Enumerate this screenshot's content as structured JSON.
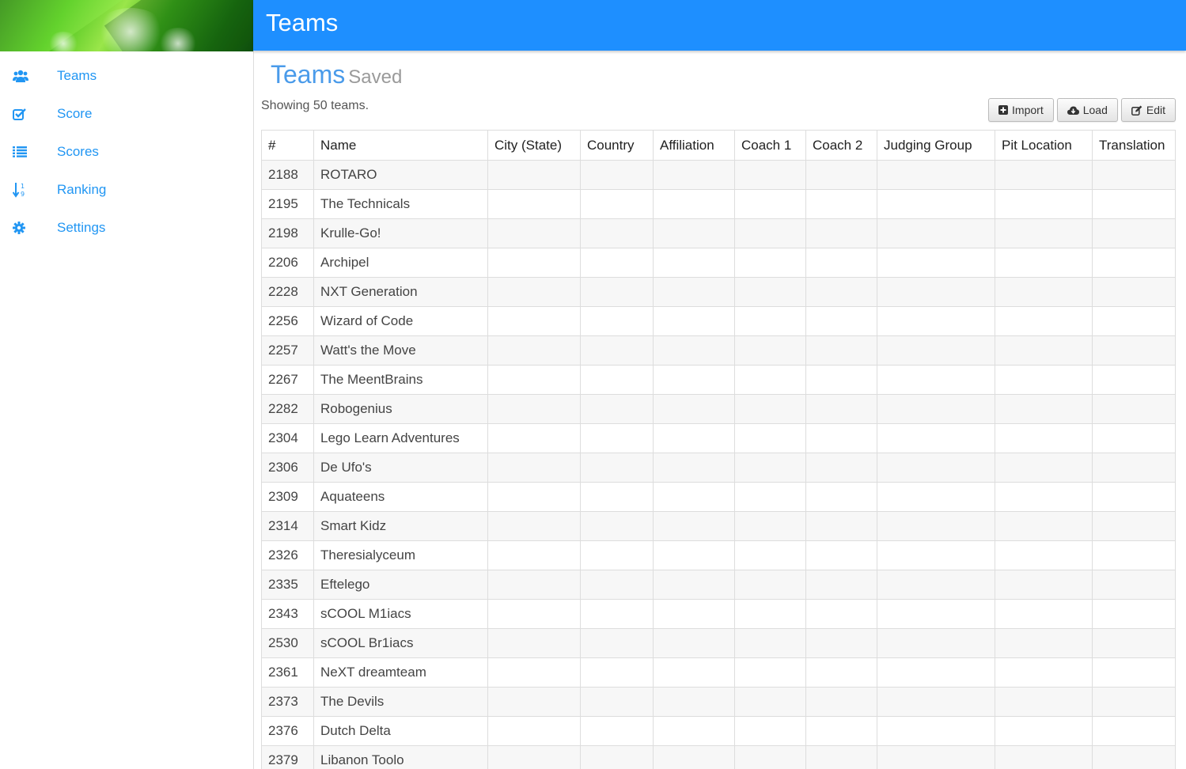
{
  "header": {
    "title": "Teams"
  },
  "sidebar": {
    "items": [
      {
        "icon": "users-icon",
        "label": "Teams"
      },
      {
        "icon": "check-square-icon",
        "label": "Score"
      },
      {
        "icon": "list-icon",
        "label": "Scores"
      },
      {
        "icon": "sort-numeric-icon",
        "label": "Ranking"
      },
      {
        "icon": "gear-icon",
        "label": "Settings"
      }
    ]
  },
  "main": {
    "title": "Teams",
    "subtitle": "Saved",
    "count_text": "Showing 50 teams.",
    "toolbar": {
      "import_label": "Import",
      "load_label": "Load",
      "edit_label": "Edit"
    },
    "table": {
      "columns": [
        "#",
        "Name",
        "City (State)",
        "Country",
        "Affiliation",
        "Coach 1",
        "Coach 2",
        "Judging Group",
        "Pit Location",
        "Translation"
      ],
      "rows": [
        [
          "2188",
          "ROTARO"
        ],
        [
          "2195",
          "The Technicals"
        ],
        [
          "2198",
          "Krulle-Go!"
        ],
        [
          "2206",
          "Archipel"
        ],
        [
          "2228",
          "NXT Generation"
        ],
        [
          "2256",
          "Wizard of Code"
        ],
        [
          "2257",
          "Watt's the Move"
        ],
        [
          "2267",
          "The MeentBrains"
        ],
        [
          "2282",
          "Robogenius"
        ],
        [
          "2304",
          "Lego Learn Adventures"
        ],
        [
          "2306",
          "De Ufo's"
        ],
        [
          "2309",
          "Aquateens"
        ],
        [
          "2314",
          "Smart Kidz"
        ],
        [
          "2326",
          "Theresialyceum"
        ],
        [
          "2335",
          "Eftelego"
        ],
        [
          "2343",
          "sCOOL M1iacs"
        ],
        [
          "2530",
          "sCOOL Br1iacs"
        ],
        [
          "2361",
          "NeXT dreamteam"
        ],
        [
          "2373",
          "The Devils"
        ],
        [
          "2376",
          "Dutch Delta"
        ],
        [
          "2379",
          "Libanon Toolo"
        ]
      ]
    }
  },
  "colors": {
    "header_bg": "#1e8fff",
    "accent": "#2196f3",
    "title": "#4a9bea"
  }
}
